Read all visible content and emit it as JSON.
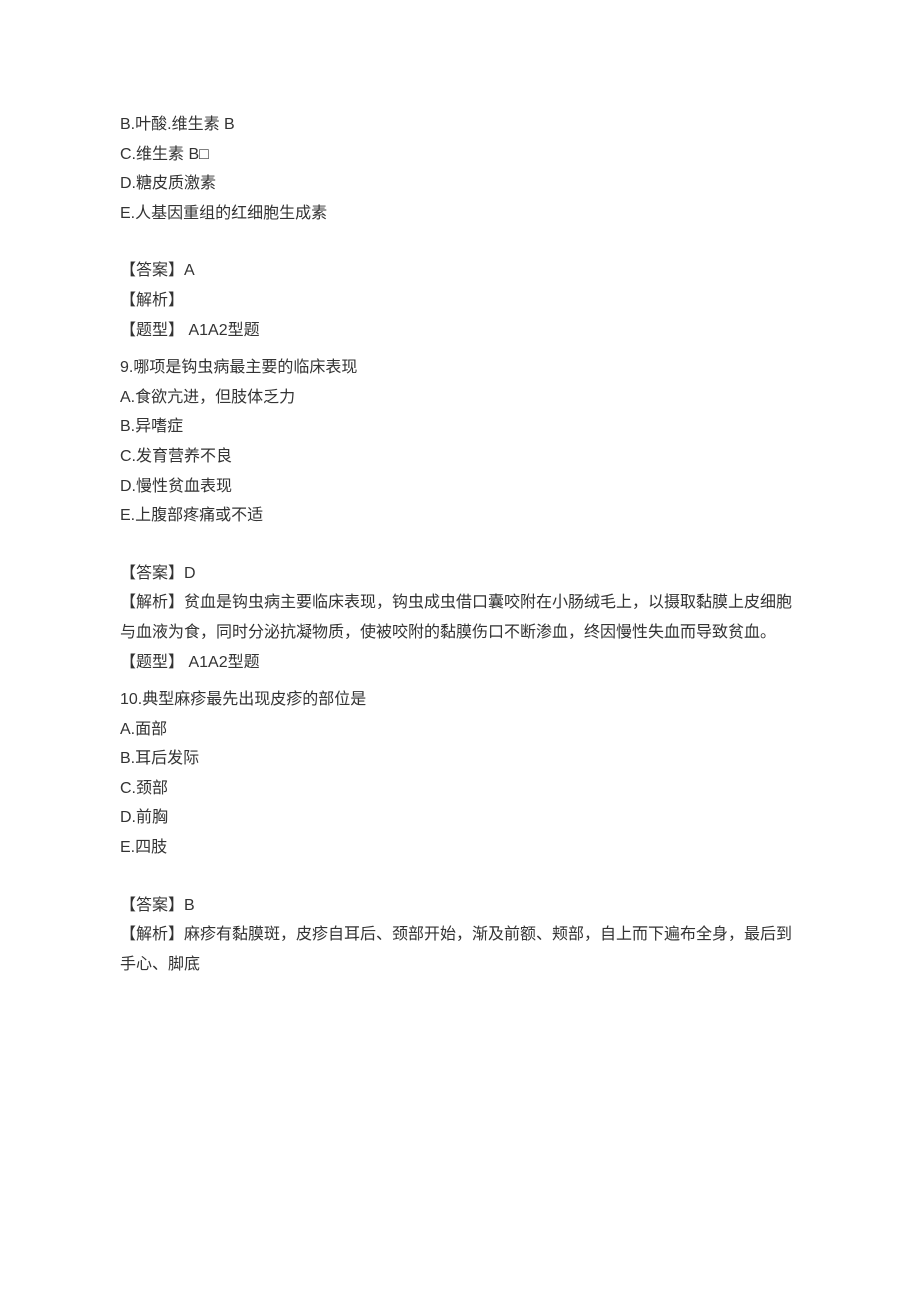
{
  "labels": {
    "answer": "【答案】",
    "analysis": "【解析】",
    "type": "【题型】"
  },
  "q8_fragment": {
    "options": {
      "B": "B.叶酸.维生素 B",
      "C": "C.维生素 B□",
      "D": "D.糖皮质激素",
      "E": "E.人基因重组的红细胞生成素"
    },
    "answer": "A",
    "analysis": "",
    "type": " A1A2型题"
  },
  "q9": {
    "stem": "9.哪项是钩虫病最主要的临床表现",
    "options": {
      "A": "A.食欲亢进，但肢体乏力",
      "B": "B.异嗜症",
      "C": "C.发育营养不良",
      "D": "D.慢性贫血表现",
      "E": "E.上腹部疼痛或不适"
    },
    "answer": "D",
    "analysis": "贫血是钩虫病主要临床表现，钩虫成虫借口囊咬附在小肠绒毛上，以摄取黏膜上皮细胞与血液为食，同时分泌抗凝物质，使被咬附的黏膜伤口不断渗血，终因慢性失血而导致贫血。",
    "type": " A1A2型题"
  },
  "q10": {
    "stem": "10.典型麻疹最先出现皮疹的部位是",
    "options": {
      "A": "A.面部",
      "B": "B.耳后发际",
      "C": "C.颈部",
      "D": "D.前胸",
      "E": "E.四肢"
    },
    "answer": "B",
    "analysis": "麻疹有黏膜斑，皮疹自耳后、颈部开始，渐及前额、颊部，自上而下遍布全身，最后到手心、脚底",
    "type": " A1A2型题"
  }
}
